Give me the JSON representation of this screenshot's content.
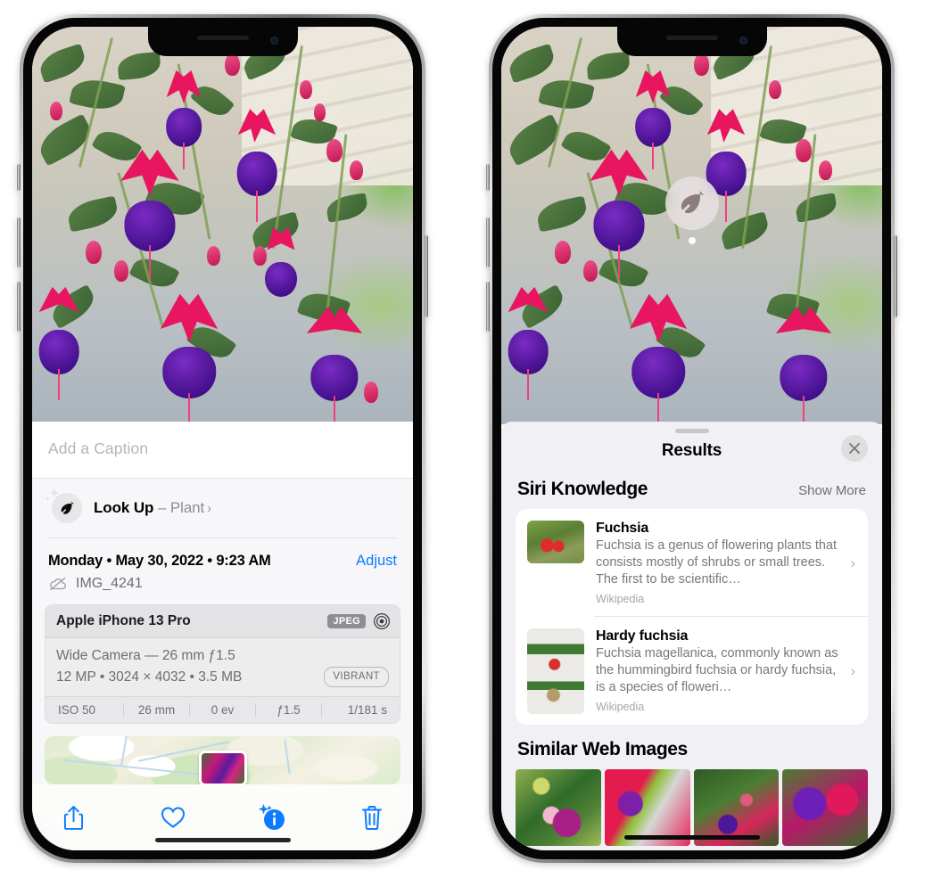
{
  "left_phone": {
    "photo": {
      "alt": "fuchsia-flowers-photo"
    },
    "caption": {
      "placeholder": "Add a Caption",
      "value": ""
    },
    "lookup": {
      "icon": "leaf-icon",
      "sparkle_icon": "sparkles-icon",
      "label": "Look Up",
      "dash": " – ",
      "subject": "Plant",
      "chevron": "›"
    },
    "meta": {
      "date": "Monday • May 30, 2022 • 9:23 AM",
      "adjust_label": "Adjust",
      "cloud_icon": "icloud-slash-icon",
      "filename": "IMG_4241"
    },
    "camera": {
      "model": "Apple iPhone 13 Pro",
      "format_badge": "JPEG",
      "aperture_icon": "camera-aperture-icon",
      "lens_line": "Wide Camera — 26 mm ƒ1.5",
      "specs_line": "12 MP • 3024 × 4032 • 3.5 MB",
      "style_badge": "VIBRANT",
      "exif": [
        "ISO 50",
        "26 mm",
        "0 ev",
        "ƒ1.5",
        "1/181 s"
      ]
    },
    "map": {
      "pin": "photo-thumbnail-pin"
    },
    "toolbar": [
      {
        "name": "share-button",
        "icon": "share-icon"
      },
      {
        "name": "favorite-button",
        "icon": "heart-icon"
      },
      {
        "name": "info-button",
        "icon": "info-sparkle-icon"
      },
      {
        "name": "delete-button",
        "icon": "trash-icon"
      }
    ],
    "accent_color": "#0a7cff"
  },
  "right_phone": {
    "visual_lookup_badge": {
      "icon": "leaf-icon"
    },
    "sheet": {
      "title": "Results",
      "close_icon": "close-icon",
      "grabber": "drag-handle"
    },
    "siri_knowledge": {
      "section_title": "Siri Knowledge",
      "show_more": "Show More",
      "items": [
        {
          "thumb": "fuchsia-red-flowers-thumbnail",
          "name": "Fuchsia",
          "description": "Fuchsia is a genus of flowering plants that consists mostly of shrubs or small trees. The first to be scientific…",
          "source": "Wikipedia",
          "chevron": "›"
        },
        {
          "thumb": "hardy-fuchsia-specimen-thumbnail",
          "name": "Hardy fuchsia",
          "description": "Fuchsia magellanica, commonly known as the hummingbird fuchsia or hardy fuchsia, is a species of floweri…",
          "source": "Wikipedia",
          "chevron": "›"
        }
      ]
    },
    "similar_web_images": {
      "section_title": "Similar Web Images",
      "thumbnails": [
        "fuchsia-pink-purple-bloom",
        "fuchsia-red-closeup",
        "fuchsia-bush-buds",
        "fuchsia-purple-magenta-cluster"
      ]
    }
  }
}
